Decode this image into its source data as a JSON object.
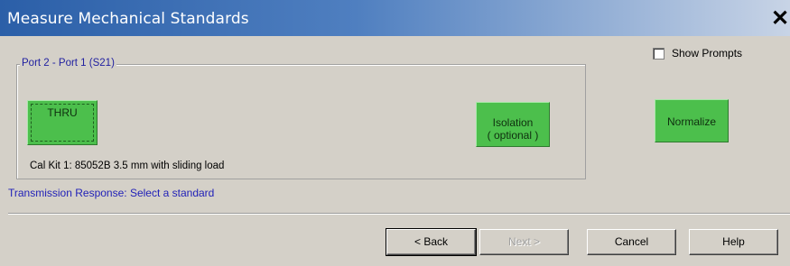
{
  "window": {
    "title": "Measure Mechanical Standards",
    "close_symbol": "✕"
  },
  "options": {
    "show_prompts_label": "Show Prompts",
    "show_prompts_checked": false
  },
  "group": {
    "title": "Port 2 - Port 1 (S21)",
    "buttons": {
      "thru": "THRU",
      "isolation_line1": "Isolation",
      "isolation_line2": "( optional )"
    },
    "cal_kit": "Cal Kit 1: 85052B 3.5 mm with sliding load"
  },
  "normalize_label": "Normalize",
  "status_text": "Transmission Response: Select a standard",
  "footer": {
    "back": "< Back",
    "next": "Next >",
    "cancel": "Cancel",
    "help": "Help"
  },
  "colors": {
    "standard_button": "#4cbf4c",
    "status_text": "#1f1fb8",
    "title_gradient_start": "#2b5fa8"
  },
  "icons": {
    "close": "close-icon",
    "checkbox": "checkbox"
  }
}
